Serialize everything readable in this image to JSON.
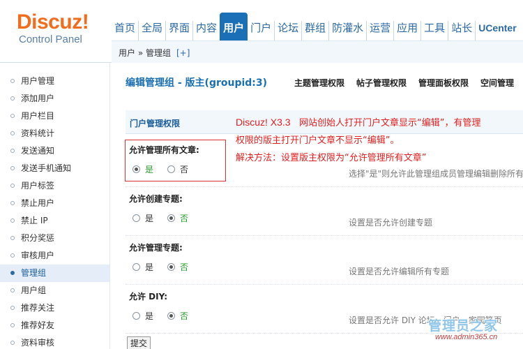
{
  "logo": {
    "name": "Discuz!",
    "subtitle": "Control Panel"
  },
  "nav": {
    "tabs": [
      "首页",
      "全局",
      "界面",
      "内容",
      "用户",
      "门户",
      "论坛",
      "群组",
      "防灌水",
      "运营",
      "应用",
      "工具",
      "站长",
      "UCenter"
    ],
    "active_index": 4
  },
  "breadcrumb": {
    "text": "用户 » 管理组",
    "plus": "[+]"
  },
  "sidebar": {
    "items": [
      "用户管理",
      "添加用户",
      "用户栏目",
      "资料统计",
      "发送通知",
      "发送手机通知",
      "用户标签",
      "禁止用户",
      "禁止 IP",
      "积分奖惩",
      "审核用户",
      "管理组",
      "用户组",
      "推荐关注",
      "推荐好友",
      "资料审核"
    ],
    "active_index": 11
  },
  "main": {
    "title": "编辑管理组 - 版主(groupid:3)",
    "subtabs": [
      "主题管理权限",
      "帖子管理权限",
      "管理面板权限",
      "空间管理"
    ],
    "section_title": "门户管理权限",
    "settings": [
      {
        "label": "允许管理所有文章:",
        "yes": "是",
        "no": "否",
        "selected": "yes",
        "desc": "选择\"是\"则允许此管理组成员管理编辑删除所有"
      },
      {
        "label": "允许创建专题:",
        "yes": "是",
        "no": "否",
        "selected": "no",
        "desc": "设置是否允许创建专题"
      },
      {
        "label": "允许管理专题:",
        "yes": "是",
        "no": "否",
        "selected": "no",
        "desc": "设置是否允许编辑所有专题"
      },
      {
        "label": "允许 DIY:",
        "yes": "是",
        "no": "否",
        "selected": "no",
        "desc": "设置是否允许 DIY 论坛、门户、家园等页"
      }
    ],
    "submit_label": "提交"
  },
  "annotation": {
    "version": "Discuz! X3.3",
    "line1": "网站创始人打开门户文章显示“编辑”，有管理",
    "line2": "权限的版主打开门户文章不显示“编辑”。",
    "line3": "解决方法：设置版主权限为“允许管理所有文章”"
  },
  "watermark": {
    "title": "管理员之家",
    "url": "www.admin365.cn"
  },
  "colors": {
    "brand": "#f26c1e",
    "nav_active": "#1b6fb6",
    "annotation": "#e02020",
    "link": "#2b6aa6"
  },
  "icons": {
    "sidebar_bullet": "circle-bullet-icon",
    "radio": "radio-button-icon"
  }
}
